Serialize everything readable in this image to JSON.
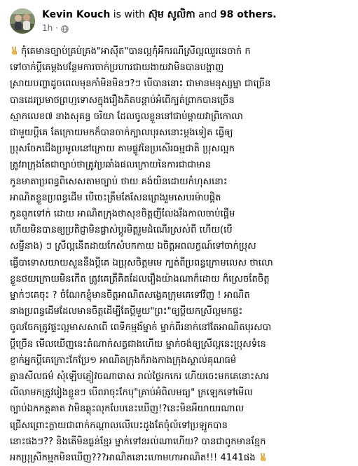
{
  "post": {
    "author": "Kevin Kouch",
    "is_with": "is with",
    "tagged_person": "ស៊ុម សូលិកា",
    "and_text": "and",
    "others_count": "98 others.",
    "timestamp": "1h",
    "separator": "·",
    "audience_icon": "globe-icon",
    "emoji_icon": "victory-hand-icon",
    "body_lines": [
      "កុំគេមានច្បាប់គ្រប់គ្រង\"អាស៊ីត\"បានល្អកុំអីករណីស្រីល្អឈួរនេចាក់ ក",
      "ទៅចាក់ប្តីគេម្តងបន្ថែមការចាក់ប្រហារជាយងាយវាមិនបានបង្ហាញ",
      "ស្រាយបញ្ហាដូចពេលមុនកាំមិនមិនៗ?ៗ បើបាននោះ ជាមានមនុស្សម្នា ជាច្រើន",
      "បានដេរប្រមាថព្រហ្មទោសក្នុងរឿងភិតបន្តាប់អំពើក្បត់ព្រាកបានច្រើន",
      "ស្មាកលេខ៧ នាងសុគន្ធ ចរិយា ដែលចូលខ្លួននៅជាប់ម្ដាយវាព្រិកោលា",
      "ជាមួយប្តីគេ តែក្រោយមកក៏បានចាក់ក្បាលបុរសនោះម្តងទៀត ធ្វើឲ្យ",
      "ប្រុសចែកជើងប្រមូលនៅក្រោយ តាមផ្លូវនៃប្រសើរធម្មជាតិ ប្រុសល្អក",
      "ត្រូវរាក្រុងតែជាច្បាប់ថាត្រូវប្រឆាំងផលក្រោយនៃការជាជាមាន",
      "កូនមាតាប្រពន្ធពិសេសតាមច្បាប់ ថាយ គង់យិនដោយកំហុសនោះ",
      "អាណិតខ្លួនប្រពន្ធដើម បើចេះត្រឹមតែសែនព្រេងរួមសេបរម៉ាបផ្ដិត",
      "កូនពួកទៅក់ ដោយ អាណិតក្រុងថាសុខចិត្តញីលែងរឹងកាលចាប់ផ្ដើម",
      "ហើយមិនបានឲ្យប្រតិជ្ញាមិនផ្លាស់ប្តូរមិត្តរួមដំណើរស្រស់ពី ហើយ(បើ",
      "សម្ផីនាង) ៗ ស្រីល្អនើតដាយកែសំបកកាយ ឯចិត្តអពលក្ខណ៍ទៅចាក់ប្រុស",
      "ធ្វើបាទោសយាយសួននឹងប្តីគេ ឯប្រុសចិត្តមមេ ក្បត់ពីប្រពន្ធក្រោមលេស ថាលោ",
      "ខ្លួនថយក្រោយមិនកើត ត្រូវគេត្រឹគិតដែលរឿងយ៉ាងណាក៏ដោយ ក៏ស្រេចតែចិត្ត",
      "ម្នាក់ៗគេចុះ ? ចំណែកខ្ញុំមានចិត្តអាណិតសង្វេគក្រុមគេទៅវិញ ! អាណិត",
      "នាងប្រពន្ធដើមដែលមានចិត្តដើម្បីតែប្តីមួយ\"ព្រះ\"ឲ្យប្តីយកស្រីល្អមកផ្ទះ",
      "ចូលចែកត្រូវផ្ទះល្អមាសសាពើ ពេទីកម្មង័ម្នាក់ ម្នាក់ពីរនាក់នៅតែអាណិតបុរសបា",
      "ប្តីច្រើន មើលឃើញនេះតំណាក់សត្វជាងហើយ ម្នាក់ចង់ឲ្យស្រីល្អនេះប្រុសទំនេ",
      "ខ្ញាក់អ្នកប្តីគេក្រោះកែប្រែ១ អាណិតក្រុងក៏រាងកាងក្រុងស្គាល់គុណធម៌",
      "គ្នានសីលធម៌ សុំឡើបភ្ញៀវចណារោស រាល់ថ្ងៃរកកេរ ហើយចេះមកគេនោះសារ",
      "លីលាមកត្រូវរៀងខ្លួនៗ បើពរាចុះកែបុ\"គ្រាប់អំពិលមធ្យ\" ក្រឡេកទៅមើល",
      "ច្បាប់ឯកកត្តគាត វាមិនឆ្លុះលុកបែបនេះឃើញ!?នេះមិនអីយាយរណាល",
      "ជ្រើសព្រោះក្លាយជាពាក់កណ្តាលលើបេះដូងតែចុំលំទៅប្រឡូកបាន",
      "នោះផងៗ?? និងតើមិនធ្ងន់ខ្មែរ ម្នាក់ទៅនរល់ណាហើយ? បានជាពូកមានខ្មែក",
      "អកប្រុស្រីកម្មកមិនឃើញ???អាណិតនោះហោមហាអាណិត!!! 4141ផង"
    ]
  }
}
